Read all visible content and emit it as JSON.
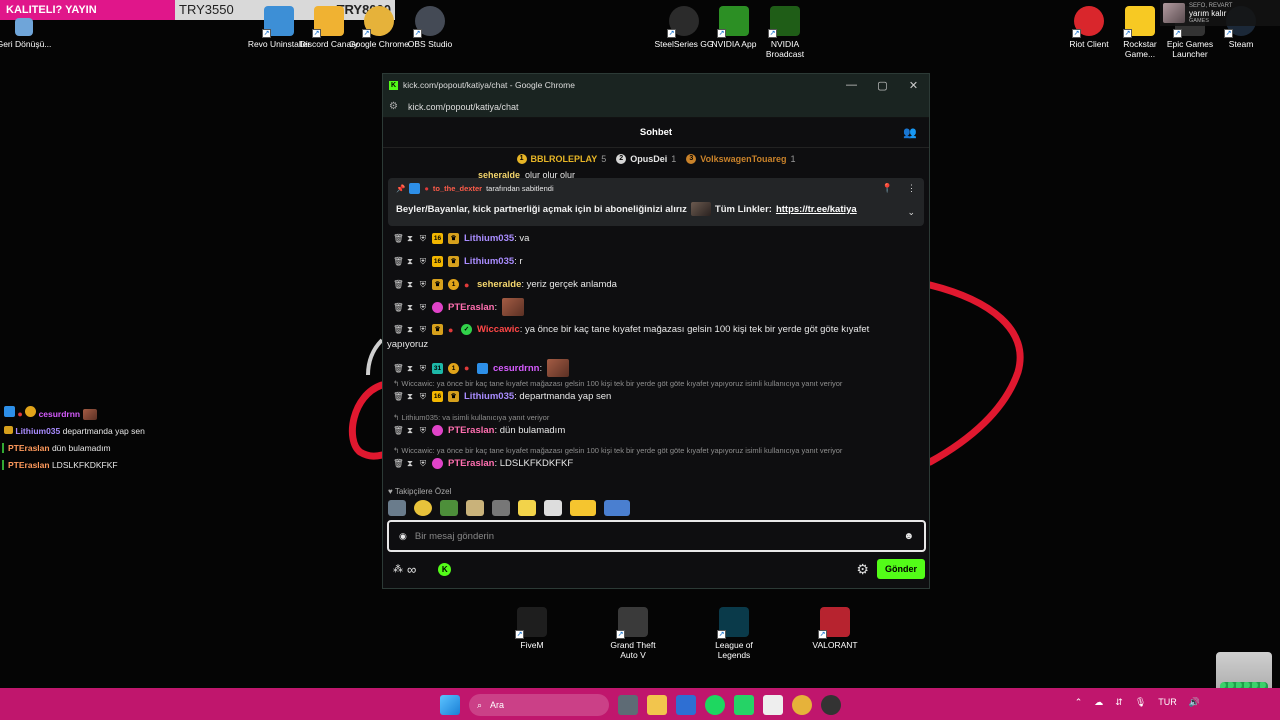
{
  "overlay": {
    "left_text": "KALITELI? YAYIN",
    "mid_text": "TRY3550",
    "right_text": "TRY8000"
  },
  "desktop_icons": [
    {
      "label": "Geri Dönüşü...",
      "color": "#6fa5d9"
    },
    {
      "label": "Revo Uninstaller",
      "color": "#3d8fd6"
    },
    {
      "label": "Discord Canary",
      "color": "#f0b232"
    },
    {
      "label": "Google Chrome",
      "color": "#e6b23a"
    },
    {
      "label": "OBS Studio",
      "color": "#444a55"
    },
    {
      "label": "SteelSeries GG",
      "color": "#2b2b2b"
    },
    {
      "label": "NVIDIA App",
      "color": "#2c8f24"
    },
    {
      "label": "NVIDIA Broadcast",
      "color": "#1f5d17"
    },
    {
      "label": "Riot Client",
      "color": "#d9262c"
    },
    {
      "label": "Rockstar Game...",
      "color": "#f7c923"
    },
    {
      "label": "Epic Games Launcher",
      "color": "#333333"
    },
    {
      "label": "Steam",
      "color": "#1b2838"
    },
    {
      "label": "FiveM",
      "color": "#1e1e1e"
    },
    {
      "label": "Grand Theft Auto V",
      "color": "#3a3a3a"
    },
    {
      "label": "League of Legends",
      "color": "#0a3a4a"
    },
    {
      "label": "VALORANT",
      "color": "#b7232f"
    }
  ],
  "notification": {
    "title": "SEFO, REVART",
    "text": "yarım kalır",
    "sub": "GAMES"
  },
  "window": {
    "title": "kick.com/popout/katiya/chat - Google Chrome",
    "url": "kick.com/popout/katiya/chat",
    "chat_title": "Sohbet"
  },
  "leaderboard": [
    {
      "rank": "1",
      "name": "BBLROLEPLAY",
      "count": "5",
      "color": "#e7b526"
    },
    {
      "rank": "2",
      "name": "OpusDei",
      "count": "1",
      "color": "#d6d6d6"
    },
    {
      "rank": "3",
      "name": "VolkswagenTouareg",
      "count": "1",
      "color": "#c9822a"
    }
  ],
  "partial_top": {
    "user": "seheralde",
    "text": "olur olur olur"
  },
  "pinned": {
    "by_user": "to_the_dexter",
    "by_suffix": "tarafından sabitlendi",
    "message": "Beyler/Bayanlar, kick partnerliği açmak için bi aboneliğinizi alırız",
    "links_label": "Tüm Linkler:",
    "link": "https://tr.ee/katiya"
  },
  "messages": [
    {
      "user": "Lithium035",
      "color": "#a98cff",
      "text": ": va"
    },
    {
      "user": "Lithium035",
      "color": "#a98cff",
      "text": ": r"
    },
    {
      "user": "seheralde",
      "color": "#f5d76e",
      "text": ": yeriz gerçek anlamda"
    },
    {
      "user": "PTEraslan",
      "color": "#ff6fb0",
      "text": ":"
    },
    {
      "user": "Wiccawic",
      "color": "#ff4747",
      "text": ": ya önce bir kaç tane kıyafet mağazası gelsin 100 kişi tek bir yerde göt göte kıyafet",
      "text2": "yapıyoruz"
    },
    {
      "user": "cesurdrnn",
      "color": "#d65cff",
      "text": ":"
    },
    {
      "reply": "Wiccawic: ya önce bir kaç tane kıyafet mağazası gelsin 100 kişi tek bir yerde göt göte kıyafet yapıyoruz isimli kullanıcıya yanıt veriyor",
      "user": "Lithium035",
      "color": "#a98cff",
      "text": ": departmanda yap sen"
    },
    {
      "reply": "Lithium035: va isimli kullanıcıya yanıt veriyor",
      "user": "PTEraslan",
      "color": "#ff6fb0",
      "text": ": dün bulamadım"
    },
    {
      "reply": "Wiccawic: ya önce bir kaç tane kıyafet mağazası gelsin 100 kişi tek bir yerde göt göte kıyafet yapıyoruz isimli kullanıcıya yanıt veriyor",
      "user": "PTEraslan",
      "color": "#ff6fb0",
      "text": ": LDSLKFKDKFKF"
    }
  ],
  "followers_label": "Takipçilere Özel",
  "input_placeholder": "Bir mesaj gönderin",
  "send_label": "Gönder",
  "left_chat": [
    {
      "user": "cesurdrnn",
      "color": "#d65cff",
      "text": ""
    },
    {
      "user": "Lithium035",
      "color": "#a98cff",
      "text": "departmanda yap sen"
    },
    {
      "user": "PTEraslan",
      "color": "#ff9a5c",
      "text": "dün bulamadım"
    },
    {
      "user": "PTEraslan",
      "color": "#ff9a5c",
      "text": "LDSLKFKDKFKF"
    }
  ],
  "taskbar": {
    "search": "Ara",
    "lang": "TUR"
  }
}
